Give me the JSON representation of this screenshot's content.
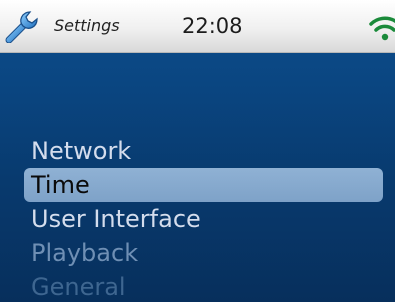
{
  "status_bar": {
    "app_name": "Settings",
    "time": "22:08",
    "app_icon": "wrench-icon",
    "signal_icon": "wifi-icon",
    "signal_color": "#1a8a3a"
  },
  "menu": {
    "items": [
      {
        "label": "Network",
        "state": "normal"
      },
      {
        "label": "Time",
        "state": "selected"
      },
      {
        "label": "User Interface",
        "state": "normal"
      },
      {
        "label": "Playback",
        "state": "dimmed"
      },
      {
        "label": "General",
        "state": "dimmed"
      }
    ],
    "selected_color": "#86a9cf",
    "background_color": "#0a4580"
  }
}
